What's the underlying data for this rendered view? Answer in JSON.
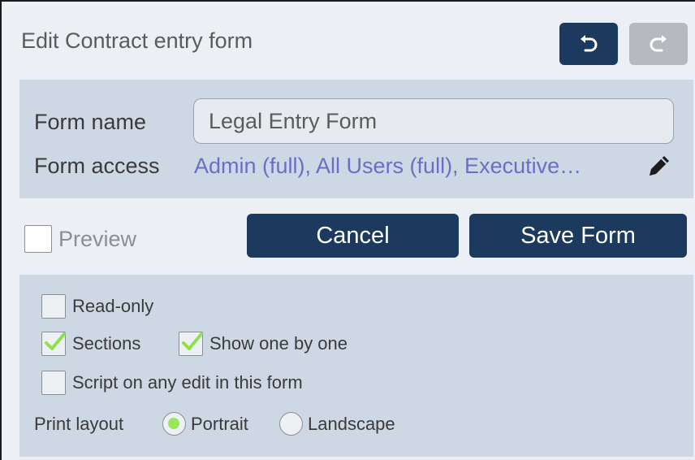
{
  "header": {
    "title": "Edit Contract entry form",
    "undo_icon": "undo-icon",
    "redo_icon": "redo-icon"
  },
  "form_info": {
    "name_label": "Form name",
    "name_value": "Legal Entry Form",
    "access_label": "Form access",
    "access_value": "Admin (full), All Users (full), Executive…",
    "edit_icon": "pencil-icon"
  },
  "actions": {
    "preview_label": "Preview",
    "preview_checked": false,
    "cancel_label": "Cancel",
    "save_label": "Save Form"
  },
  "options": {
    "read_only_label": "Read-only",
    "read_only_checked": false,
    "sections_label": "Sections",
    "sections_checked": true,
    "show_one_by_one_label": "Show one by one",
    "show_one_by_one_checked": true,
    "script_label": "Script on any edit in this form",
    "script_checked": false,
    "print_layout_label": "Print layout",
    "portrait_label": "Portrait",
    "landscape_label": "Landscape",
    "print_layout_selected": "Portrait"
  },
  "colors": {
    "primary": "#1c3a5e",
    "disabled": "#b6b9be",
    "panel": "#cdd8e4",
    "link": "#6b6fc4",
    "check": "#8ee04f"
  }
}
